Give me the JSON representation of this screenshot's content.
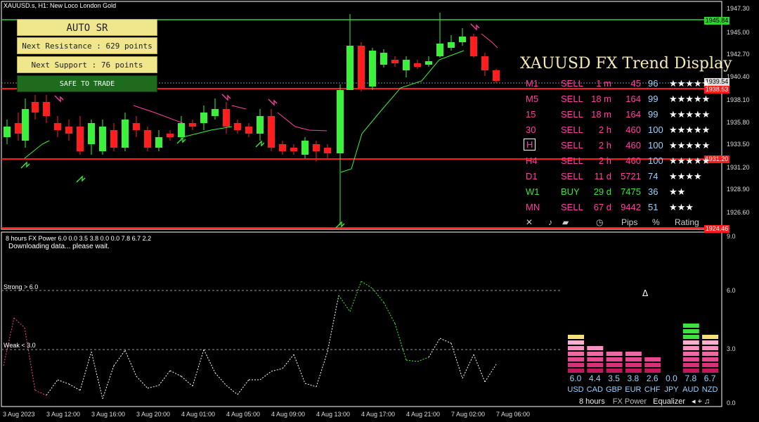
{
  "chart_title": "XAUUSD.s, H1:  New Loco London Gold",
  "sr_panel": {
    "title": "AUTO SR",
    "resistance": "Next Resistance : 629 points",
    "support": "Next Support : 76 points",
    "status": "SAFE TO TRADE"
  },
  "trend_display": {
    "title": "XAUUSD FX Trend Display",
    "rows": [
      {
        "tf": "M1",
        "signal": "SELL",
        "dur": "1 m",
        "pips": "45",
        "pct": "96",
        "stars": "★★★★★",
        "color": "#ff3fa4"
      },
      {
        "tf": "M5",
        "signal": "SELL",
        "dur": "18 m",
        "pips": "164",
        "pct": "99",
        "stars": "★★★★★",
        "color": "#ff3fa4"
      },
      {
        "tf": "15",
        "signal": "SELL",
        "dur": "18 m",
        "pips": "164",
        "pct": "99",
        "stars": "★★★★★",
        "color": "#ff3fa4"
      },
      {
        "tf": "30",
        "signal": "SELL",
        "dur": "2 h",
        "pips": "460",
        "pct": "100",
        "stars": "★★★★★",
        "color": "#ff3fa4"
      },
      {
        "tf": "H",
        "signal": "SELL",
        "dur": "2 h",
        "pips": "460",
        "pct": "100",
        "stars": "★★★★★",
        "color": "#ff3fa4"
      },
      {
        "tf": "H4",
        "signal": "SELL",
        "dur": "2 h",
        "pips": "460",
        "pct": "100",
        "stars": "★★★★★",
        "color": "#ff3fa4"
      },
      {
        "tf": "D1",
        "signal": "SELL",
        "dur": "11 d",
        "pips": "5721",
        "pct": "74",
        "stars": "★★★★",
        "color": "#ff3fa4"
      },
      {
        "tf": "W1",
        "signal": "BUY",
        "dur": "29 d",
        "pips": "7475",
        "pct": "36",
        "stars": "★★",
        "color": "#39e639"
      },
      {
        "tf": "MN",
        "signal": "SELL",
        "dur": "67 d",
        "pips": "9442",
        "pct": "51",
        "stars": "★★★",
        "color": "#ff3fa4"
      }
    ],
    "footer": {
      "close": "✕",
      "music": "♪",
      "clock": "◷",
      "pips": "Pips",
      "pct": "%",
      "rating": "Rating"
    }
  },
  "price_axis": [
    "1947.30",
    "1945.00",
    "1942.70",
    "1940.40",
    "1938.10",
    "1935.80",
    "1933.50",
    "1931.20",
    "1928.90",
    "1926.60"
  ],
  "price_tags": {
    "top": "1945.84",
    "current": "1939.54",
    "current2": "1938.53",
    "support": "1931.20",
    "bottom": "1924.46"
  },
  "indicator": {
    "title": "8 hours FX Power 6.0 0.0 3.5 3.8 0.0 0.0 7.8 6.7 2.2",
    "status": "Downloading data... please wait.",
    "strong": "Strong > 6.0",
    "weak": "Weak < 3.0",
    "axis": [
      "9.0",
      "6.0",
      "3.0",
      "0.0"
    ],
    "delta": "Δ"
  },
  "equalizer": {
    "currencies": [
      {
        "name": "USD",
        "value": "6.0",
        "level": 6.0
      },
      {
        "name": "CAD",
        "value": "4.4",
        "level": 4.4
      },
      {
        "name": "GBP",
        "value": "3.5",
        "level": 3.5
      },
      {
        "name": "EUR",
        "value": "3.8",
        "level": 3.8
      },
      {
        "name": "CHF",
        "value": "2.6",
        "level": 2.6
      },
      {
        "name": "JPY",
        "value": "0.0",
        "level": 0.0
      },
      {
        "name": "AUD",
        "value": "7.8",
        "level": 7.8
      },
      {
        "name": "NZD",
        "value": "6.7",
        "level": 6.7
      }
    ],
    "footer": {
      "period": "8 hours",
      "name": "FX Power",
      "mode": "Equalizer",
      "icons": "◂ ⌖ ♫"
    }
  },
  "time_axis": [
    "3 Aug 2023",
    "3 Aug 12:00",
    "3 Aug 16:00",
    "3 Aug 20:00",
    "4 Aug 01:00",
    "4 Aug 05:00",
    "4 Aug 09:00",
    "4 Aug 13:00",
    "4 Aug 17:00",
    "4 Aug 21:00",
    "7 Aug 02:00",
    "7 Aug 06:00"
  ]
}
